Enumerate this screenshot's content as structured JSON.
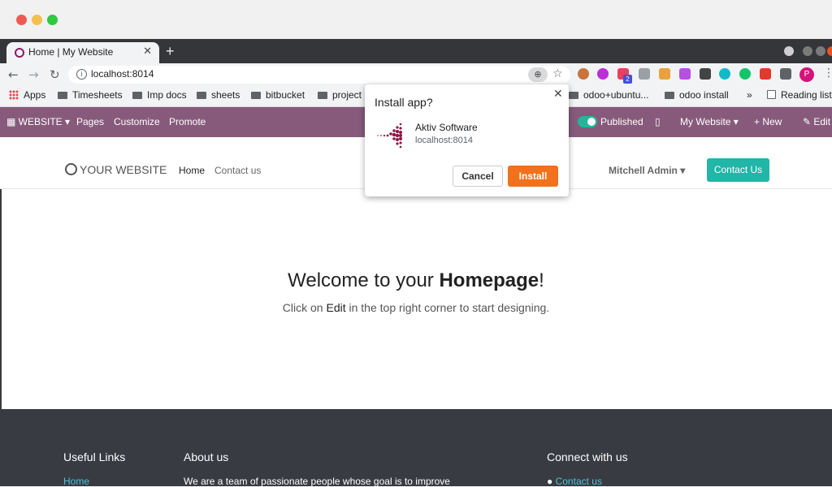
{
  "browser": {
    "tab_title": "Home | My Website",
    "new_tab": "+",
    "url": "localhost:8014",
    "bookmarks": {
      "apps": "Apps",
      "timesheets": "Timesheets",
      "imp_docs": "Imp docs",
      "sheets": "sheets",
      "bitbucket": "bitbucket",
      "project": "project",
      "odoo_ubuntu": "odoo+ubuntu...",
      "odoo_install": "odoo install",
      "more": "»",
      "reading_list": "Reading list"
    },
    "profile_initial": "P",
    "extension_badge": "2"
  },
  "odoo_bar": {
    "website": "WEBSITE",
    "pages": "Pages",
    "customize": "Customize",
    "promote": "Promote",
    "published": "Published",
    "my_website": "My Website",
    "new": "New",
    "edit": "Edit"
  },
  "site": {
    "logo": "YOUR WEBSITE",
    "nav_home": "Home",
    "nav_contact": "Contact us",
    "user": "Mitchell Admin",
    "contact_button": "Contact Us",
    "welcome_prefix": "Welcome to your ",
    "welcome_bold": "Homepage",
    "welcome_suffix": "!",
    "hint_prefix": "Click on ",
    "hint_bold": "Edit",
    "hint_suffix": " in the top right corner to start designing."
  },
  "footer": {
    "useful_links": "Useful Links",
    "about_us": "About us",
    "connect": "Connect with us",
    "home_link": "Home",
    "about_text": "We are a team of passionate people whose goal is to improve",
    "contact_link": "Contact us"
  },
  "popup": {
    "title": "Install app?",
    "app_name": "Aktiv Software",
    "app_host": "localhost:8014",
    "cancel": "Cancel",
    "install": "Install"
  },
  "colors": {
    "odoo_purple": "#875a7b",
    "teal": "#21b6a8",
    "install_orange": "#f2711c",
    "footer_bg": "#393b43"
  }
}
